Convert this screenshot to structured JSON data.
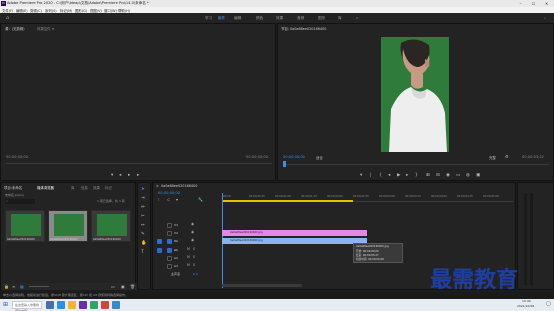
{
  "window": {
    "title": "Adobe Premiere Pro 2020 - C:\\用户\\Ideap\\文档\\Adobe\\Premiere Pro\\14.0\\未命名 *",
    "logo": "Pr"
  },
  "menu": [
    "文件(F)",
    "编辑(E)",
    "剪辑(C)",
    "序列(S)",
    "标记(M)",
    "图形(G)",
    "视图(V)",
    "窗口(W)",
    "帮助(H)"
  ],
  "workspaces": [
    "学习",
    "组件",
    "编辑",
    "颜色",
    "效果",
    "音频",
    "图形",
    "库"
  ],
  "source_monitor": {
    "tab": "源：(无剪辑)",
    "timecode_left": "00;00;00;00",
    "timecode_right": "00;00;00;00",
    "tab2": "效果控件 ≡"
  },
  "program_monitor": {
    "tab": "节目: 0a0a68ee020166400",
    "timecode_left": "00;00;00;00",
    "fit": "适合",
    "quality": "完整",
    "timecode_right": "00;00;03;22"
  },
  "project_panel": {
    "tabs": [
      "项目:未命名",
      "媒体浏览器",
      "库",
      "信息",
      "效果",
      "标记"
    ],
    "project_name": "未命名.prproj",
    "item_count": "1 项已选择，共 3 项",
    "thumbs": [
      {
        "label": "0a0a68ee020166400"
      },
      {
        "label": "0a0a68ee020166400"
      },
      {
        "label": "0a0a68ee020166400"
      }
    ]
  },
  "timeline": {
    "tab": "0a0a68ee020166400",
    "timecode": "00;00;00;00",
    "ruler": [
      "00;00",
      "00;00;00;15",
      "00;00;01;00",
      "00;00;01;15",
      "00;00;02;00",
      "00;00;02;15",
      "00;00;03;00",
      "00;00;03;15",
      "00;00;04;00",
      "00;00;04;15",
      "00;00;05;00"
    ],
    "tracks": [
      "V3",
      "V2",
      "V1",
      "A1",
      "A2",
      "A3"
    ],
    "master": "主声道",
    "master_value": "0.0",
    "clip1": "0a0a68ee020166400.jpg",
    "clip2": "0a0a68ee020166400.jpg",
    "tooltip": {
      "name": "0a0a68ee020166400.jpg",
      "start": "开始: 00;00;00;00",
      "end": "结束: 00;00;05;27",
      "duration": "持续时间: 00;00;06;00"
    }
  },
  "status_text": "单击以选择剪辑，或拖动进行框选。按Shift 键扩展选区，按Ctrl 和 Alt 键使用特殊选择操作。",
  "watermark": "最需教育",
  "taskbar": {
    "search_placeholder": "在这里输入你要搜索的内容",
    "time": "19:40",
    "date": "2021/10/26"
  },
  "colors": {
    "accent": "#3b8df0",
    "video_clip": "#e08ae6",
    "video_clip2": "#8ab4f0",
    "green_screen": "#2f7b3c"
  }
}
